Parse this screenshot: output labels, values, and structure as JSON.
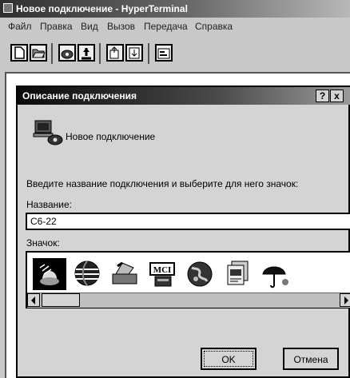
{
  "window": {
    "title": "Новое подключение - HyperTerminal"
  },
  "menu": [
    {
      "label": "Файл"
    },
    {
      "label": "Правка"
    },
    {
      "label": "Вид"
    },
    {
      "label": "Вызов"
    },
    {
      "label": "Передача"
    },
    {
      "label": "Справка"
    }
  ],
  "toolbar": {
    "buttons": [
      "new-document-icon",
      "open-folder-icon",
      "phone-dial-icon",
      "disconnect-icon",
      "send-file-icon",
      "receive-file-icon",
      "properties-icon"
    ]
  },
  "dialog": {
    "title": "Описание подключения",
    "help_label": "?",
    "close_label": "x",
    "header_text": "Новое подключение",
    "instruction": "Введите название подключения и выберите для него значок:",
    "name_label": "Название:",
    "name_value": "C6-22",
    "icon_label": "Значок:",
    "icons": [
      {
        "icon": "telephone-icon",
        "selected": true
      },
      {
        "icon": "globe-icon",
        "selected": false
      },
      {
        "icon": "phone-with-modem-icon",
        "selected": false
      },
      {
        "icon": "mci-icon",
        "selected": false,
        "text": "MCI"
      },
      {
        "icon": "earth-icon",
        "selected": false
      },
      {
        "icon": "stacked-documents-icon",
        "selected": false
      },
      {
        "icon": "umbrella-icon",
        "selected": false
      }
    ],
    "ok_label": "OK",
    "cancel_label": "Отмена"
  },
  "colors": {
    "selection": "#000000",
    "title_dark": "#0a0a0a",
    "face": "#d4d4d4"
  }
}
